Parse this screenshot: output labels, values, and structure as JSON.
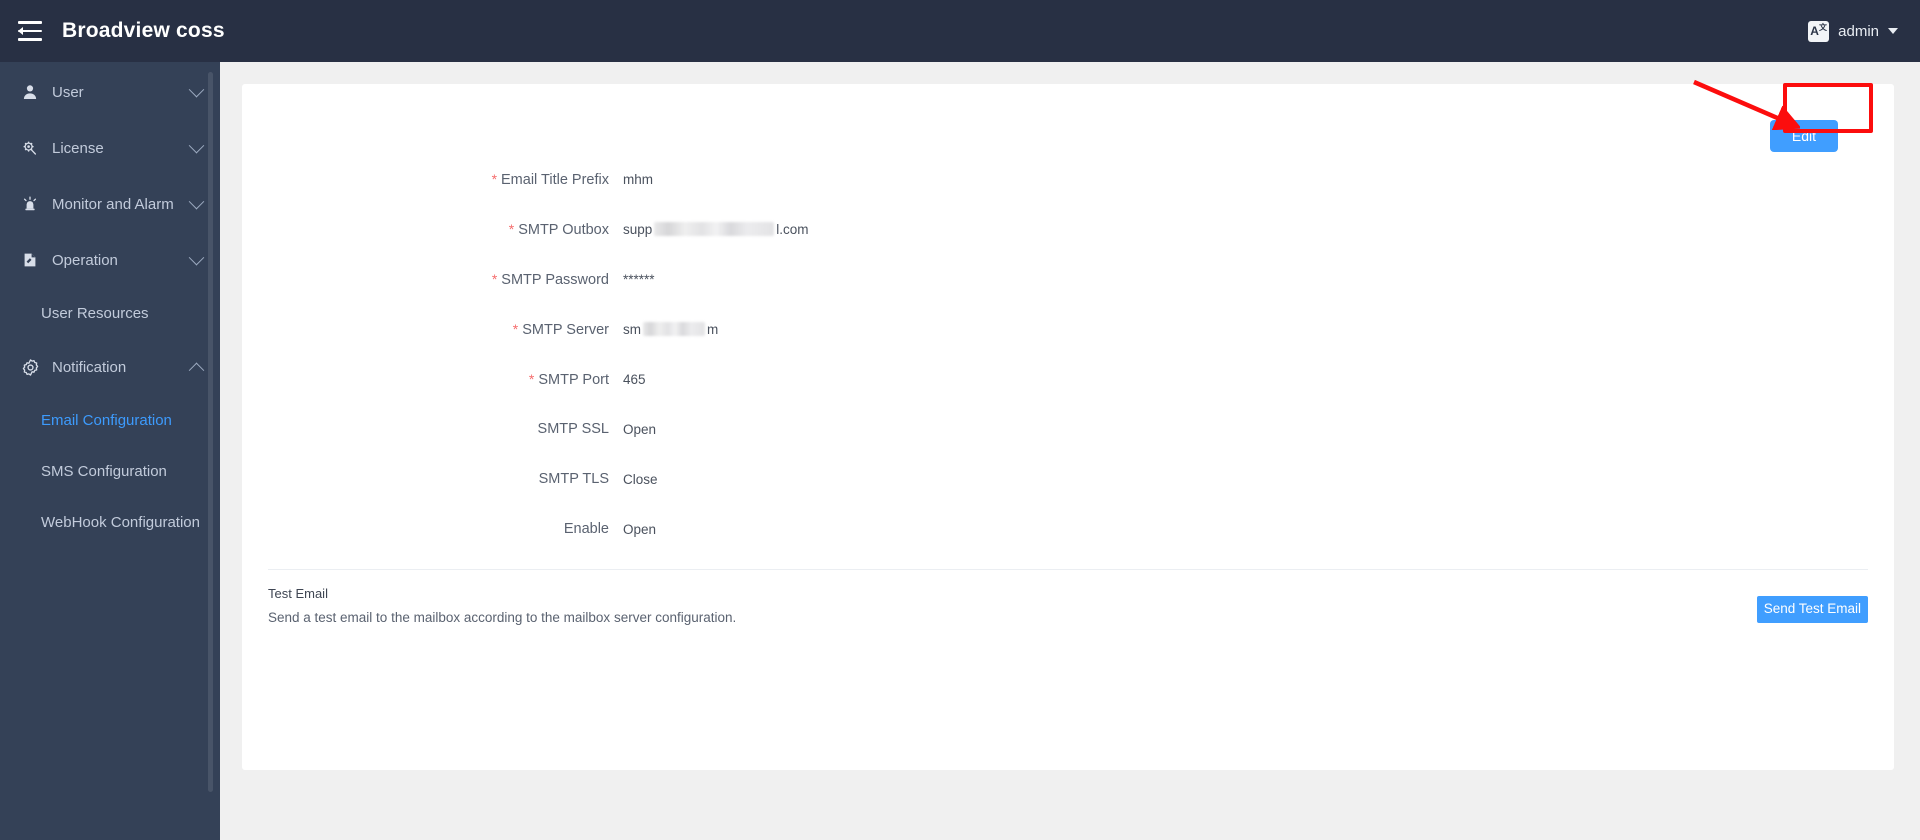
{
  "header": {
    "menu_toggle_icon": "hamburger-collapse-icon",
    "title": "Broadview coss",
    "lang_icon_letter": "A",
    "lang_icon_sup": "文",
    "user_name": "admin",
    "user_caret_icon": "chevron-down-icon"
  },
  "sidebar": {
    "items": [
      {
        "label": "User",
        "icon": "user-icon",
        "expandable": true,
        "expanded": false
      },
      {
        "label": "License",
        "icon": "license-gear-icon",
        "expandable": true,
        "expanded": false
      },
      {
        "label": "Monitor and Alarm",
        "icon": "alarm-light-icon",
        "expandable": true,
        "expanded": false
      },
      {
        "label": "Operation",
        "icon": "operation-wrench-icon",
        "expandable": true,
        "expanded": false
      }
    ],
    "operation_children": [
      {
        "label": "User Resources",
        "active": false
      }
    ],
    "notification": {
      "label": "Notification",
      "icon": "gear-icon",
      "expandable": true,
      "expanded": true
    },
    "notification_children": [
      {
        "label": "Email Configuration",
        "active": true
      },
      {
        "label": "SMS Configuration",
        "active": false
      },
      {
        "label": "WebHook Configuration",
        "active": false
      }
    ]
  },
  "main": {
    "edit_button": "Edit",
    "form_rows": [
      {
        "label": "Email Title Prefix",
        "required": true,
        "value": "mhm",
        "redacted": false
      },
      {
        "label": "SMTP Outbox",
        "required": true,
        "value": "supp",
        "value_suffix": "l.com",
        "redacted": true,
        "redacted_width": 120
      },
      {
        "label": "SMTP Password",
        "required": true,
        "value": "******",
        "redacted": false
      },
      {
        "label": "SMTP Server",
        "required": true,
        "value": "sm",
        "value_suffix": "m",
        "redacted": true,
        "redacted_width": 62
      },
      {
        "label": "SMTP Port",
        "required": true,
        "value": "465",
        "redacted": false
      },
      {
        "label": "SMTP SSL",
        "required": false,
        "value": "Open",
        "redacted": false
      },
      {
        "label": "SMTP TLS",
        "required": false,
        "value": "Close",
        "redacted": false
      },
      {
        "label": "Enable",
        "required": false,
        "value": "Open",
        "redacted": false
      }
    ],
    "required_marker": "*",
    "test_email": {
      "title": "Test Email",
      "description": "Send a test email to the mailbox according to the mailbox server configuration.",
      "button": "Send Test Email"
    }
  },
  "annotation": {
    "highlight_color": "#fc0d0d",
    "target": "Edit"
  },
  "colors": {
    "header_bg": "#283044",
    "sidebar_bg": "#344157",
    "accent_blue": "#409eff",
    "active_menu_blue": "#3d9bfd",
    "required_red": "#f56c6c",
    "page_bg": "#f0f0f0"
  }
}
